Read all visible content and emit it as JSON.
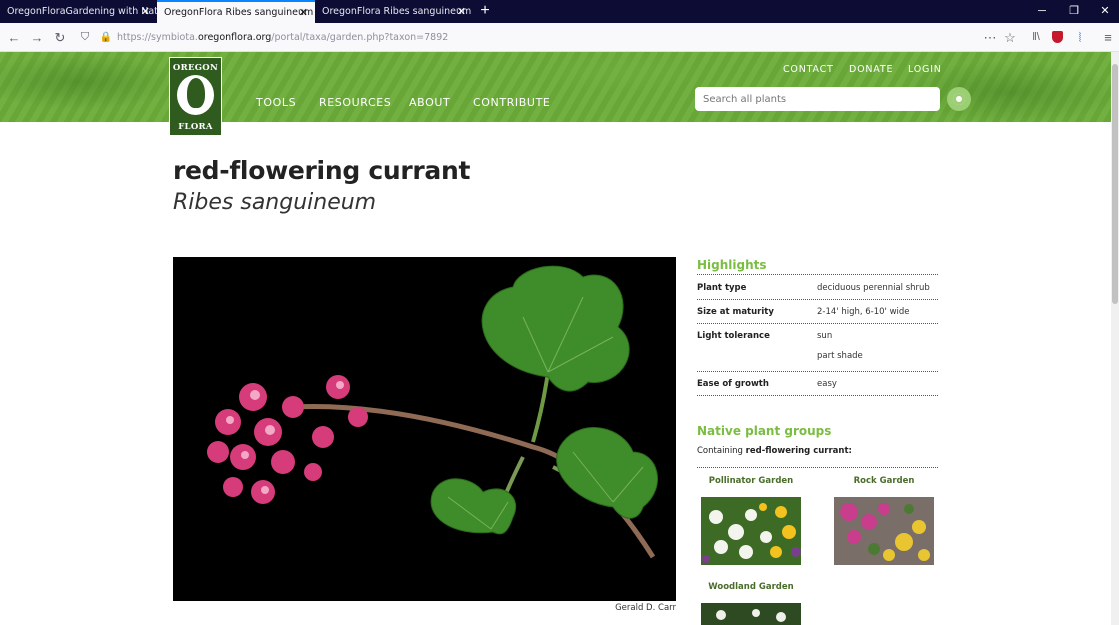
{
  "browser": {
    "tabs": [
      {
        "title": "OregonFloraGardening with Native"
      },
      {
        "title": "OregonFlora Ribes sanguineum"
      },
      {
        "title": "OregonFlora Ribes sanguineum"
      }
    ],
    "url_prefix": "https://symbiota.",
    "url_domain": "oregonflora.org",
    "url_path": "/portal/taxa/garden.php?taxon=7892"
  },
  "header": {
    "logo_top": "OREGON",
    "logo_bottom": "FLORA",
    "nav": [
      "TOOLS",
      "RESOURCES",
      "ABOUT",
      "CONTRIBUTE"
    ],
    "util": [
      "CONTACT",
      "DONATE",
      "LOGIN"
    ],
    "search_placeholder": "Search all plants"
  },
  "taxon": {
    "common_name": "red-flowering currant",
    "scientific_name": "Ribes sanguineum",
    "photo_credit": "Gerald D. Carr"
  },
  "highlights": {
    "heading": "Highlights",
    "rows": [
      {
        "label": "Plant type",
        "values": [
          "deciduous perennial shrub"
        ]
      },
      {
        "label": "Size at maturity",
        "values": [
          "2-14' high, 6-10' wide"
        ]
      },
      {
        "label": "Light tolerance",
        "values": [
          "sun",
          "part shade"
        ]
      },
      {
        "label": "Ease of growth",
        "values": [
          "easy"
        ]
      }
    ]
  },
  "groups": {
    "heading": "Native plant groups",
    "containing_prefix": "Containing ",
    "containing_name": "red-flowering currant:",
    "items": [
      {
        "title": "Pollinator Garden"
      },
      {
        "title": "Rock Garden"
      },
      {
        "title": "Woodland Garden"
      }
    ]
  },
  "colors": {
    "header_green": "#6cad3a",
    "accent_green": "#7bbd42",
    "tab_active_line": "#0a84ff"
  }
}
